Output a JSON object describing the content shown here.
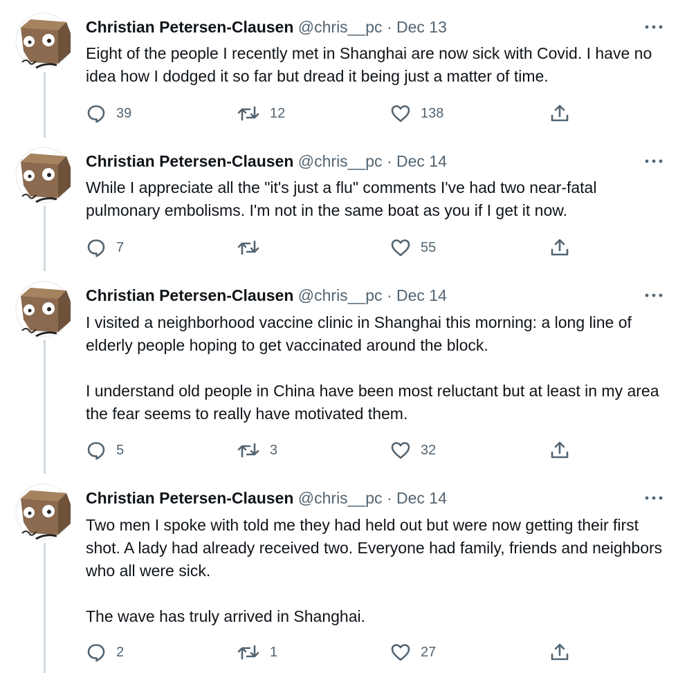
{
  "tweets": [
    {
      "name": "Christian Petersen-Clausen",
      "handle": "@chris__pc",
      "sep": "·",
      "date": "Dec 13",
      "paragraphs": [
        "Eight of the people I recently met in Shanghai are now sick with Covid. I have no idea how I dodged it so far but dread it being just a matter of time."
      ],
      "replies": "39",
      "retweets": "12",
      "likes": "138"
    },
    {
      "name": "Christian Petersen-Clausen",
      "handle": "@chris__pc",
      "sep": "·",
      "date": "Dec 14",
      "paragraphs": [
        "While I appreciate all the \"it's just a flu\" comments I've had two near-fatal pulmonary embolisms. I'm not in the same boat as you if I get it now."
      ],
      "replies": "7",
      "retweets": "",
      "likes": "55"
    },
    {
      "name": "Christian Petersen-Clausen",
      "handle": "@chris__pc",
      "sep": "·",
      "date": "Dec 14",
      "paragraphs": [
        "I visited a neighborhood vaccine clinic in Shanghai this morning: a long line of elderly people hoping to get vaccinated around the block.",
        "I understand old people in China have been most reluctant but at least in my area the fear seems to really have motivated them."
      ],
      "replies": "5",
      "retweets": "3",
      "likes": "32"
    },
    {
      "name": "Christian Petersen-Clausen",
      "handle": "@chris__pc",
      "sep": "·",
      "date": "Dec 14",
      "paragraphs": [
        "Two men I spoke with told me they had held out but were now getting their first shot. A lady had already received two. Everyone had family, friends and neighbors who all were sick.",
        "The wave has truly arrived in Shanghai."
      ],
      "replies": "2",
      "retweets": "1",
      "likes": "27"
    }
  ],
  "icons": {
    "reply": "reply-icon",
    "retweet": "retweet-icon",
    "like": "heart-icon",
    "share": "share-icon",
    "more": "more-icon"
  },
  "colors": {
    "text": "#0f1419",
    "secondary": "#536471",
    "thread_line": "#cfd9de",
    "avatar_box": "#8b6a4f"
  }
}
